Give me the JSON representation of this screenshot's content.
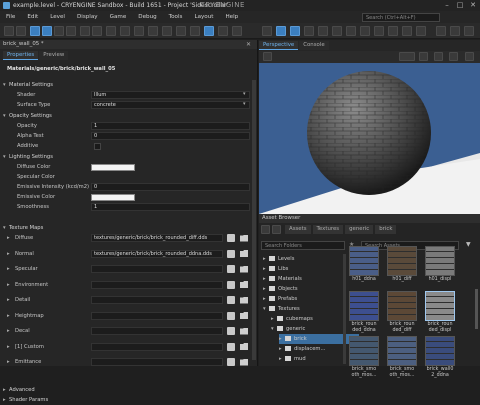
{
  "window": {
    "title": "example.level - CRYENGINE Sandbox - Build 1651 - Project 'Sidescroller'",
    "logo": "CRYENGINE"
  },
  "menu": [
    "File",
    "Edit",
    "Level",
    "Display",
    "Game",
    "Debug",
    "Tools",
    "Layout",
    "Help"
  ],
  "toolbar": {
    "search_placeholder": "Search (Ctrl+Alt+F)"
  },
  "material_editor": {
    "panel_title": "brick_wall_05 *",
    "tabs": [
      "Properties",
      "Preview"
    ],
    "material_path": "Materials/generic/brick/brick_wall_05",
    "sections": {
      "material_settings": "Material Settings",
      "opacity_settings": "Opacity Settings",
      "lighting_settings": "Lighting Settings",
      "texture_maps": "Texture Maps",
      "advanced": "Advanced",
      "shader_params": "Shader Params"
    },
    "props": {
      "shader": {
        "label": "Shader",
        "value": "Illum"
      },
      "surface_type": {
        "label": "Surface Type",
        "value": "concrete"
      },
      "opacity": {
        "label": "Opacity",
        "value": "1"
      },
      "alpha_test": {
        "label": "Alpha Test",
        "value": "0"
      },
      "additive": {
        "label": "Additive"
      },
      "diffuse_color": {
        "label": "Diffuse Color"
      },
      "specular_color": {
        "label": "Specular Color"
      },
      "emissive_intensity": {
        "label": "Emissive Intensity (kcd/m2)",
        "value": "0"
      },
      "emissive_color": {
        "label": "Emissive Color"
      },
      "smoothness": {
        "label": "Smoothness",
        "value": "1"
      }
    },
    "texture_maps": [
      {
        "label": "Diffuse",
        "value": "textures/generic/brick/brick_rounded_diff.dds"
      },
      {
        "label": "Normal",
        "value": "textures/generic/brick/brick_rounded_ddna.dds"
      },
      {
        "label": "Specular",
        "value": ""
      },
      {
        "label": "Environment",
        "value": ""
      },
      {
        "label": "Detail",
        "value": ""
      },
      {
        "label": "Heightmap",
        "value": ""
      },
      {
        "label": "Decal",
        "value": ""
      },
      {
        "label": "[1] Custom",
        "value": ""
      },
      {
        "label": "Emittance",
        "value": ""
      }
    ]
  },
  "viewport": {
    "tabs": [
      "Perspective",
      "Console"
    ]
  },
  "asset_browser": {
    "title": "Asset Browser",
    "breadcrumb": [
      "Assets",
      "Textures",
      "generic",
      "brick"
    ],
    "search_folders_placeholder": "Search Folders",
    "search_assets_placeholder": "Search Assets",
    "tree": [
      "Levels",
      "Libs",
      "Materials",
      "Objects",
      "Prefabs",
      "Textures",
      "cubemaps",
      "generic",
      "brick",
      "displacem...",
      "mud"
    ],
    "thumbnails": [
      {
        "label": "h01_ddna"
      },
      {
        "label": "h01_diff"
      },
      {
        "label": "h01_displ"
      },
      {
        "label": "brick_roun ded_ddna"
      },
      {
        "label": "brick_roun ded_diff"
      },
      {
        "label": "brick_roun ded_displ"
      },
      {
        "label": "brick_smo oth_mos..."
      },
      {
        "label": "brick_smo oth_mos..."
      },
      {
        "label": "brick_wall0 2_ddna"
      }
    ]
  },
  "colors": {
    "accent": "#3b7fc0",
    "panel": "#262626",
    "sky": "#3b5f92"
  }
}
